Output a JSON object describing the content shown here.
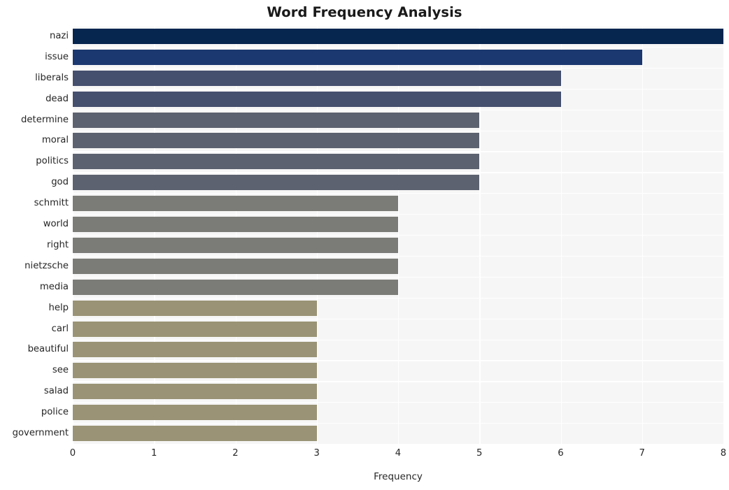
{
  "chart_data": {
    "type": "bar",
    "orientation": "horizontal",
    "title": "Word Frequency Analysis",
    "xlabel": "Frequency",
    "ylabel": "",
    "xlim": [
      0,
      8
    ],
    "xticks": [
      0,
      1,
      2,
      3,
      4,
      5,
      6,
      7,
      8
    ],
    "xtick_labels": [
      "0",
      "1",
      "2",
      "3",
      "4",
      "5",
      "6",
      "7",
      "8"
    ],
    "grid": true,
    "legend": "none",
    "categories": [
      "nazi",
      "issue",
      "liberals",
      "dead",
      "determine",
      "moral",
      "politics",
      "god",
      "schmitt",
      "world",
      "right",
      "nietzsche",
      "media",
      "help",
      "carl",
      "beautiful",
      "see",
      "salad",
      "police",
      "government"
    ],
    "values": [
      8,
      7,
      6,
      6,
      5,
      5,
      5,
      5,
      4,
      4,
      4,
      4,
      4,
      3,
      3,
      3,
      3,
      3,
      3,
      3
    ],
    "bar_colors": [
      "#06254f",
      "#1b3870",
      "#454f6e",
      "#454f6e",
      "#5d6270",
      "#5d6270",
      "#5d6270",
      "#5d6270",
      "#7b7b78",
      "#7b7b78",
      "#7b7b78",
      "#7b7b78",
      "#7b7b78",
      "#9a9375",
      "#9a9375",
      "#9a9375",
      "#9a9375",
      "#9a9375",
      "#9a9375",
      "#9a9375"
    ],
    "plot_background": "#f6f6f6",
    "gridline_color": "#ffffff",
    "figure_background": "#ffffff",
    "text_color": "#262626"
  }
}
